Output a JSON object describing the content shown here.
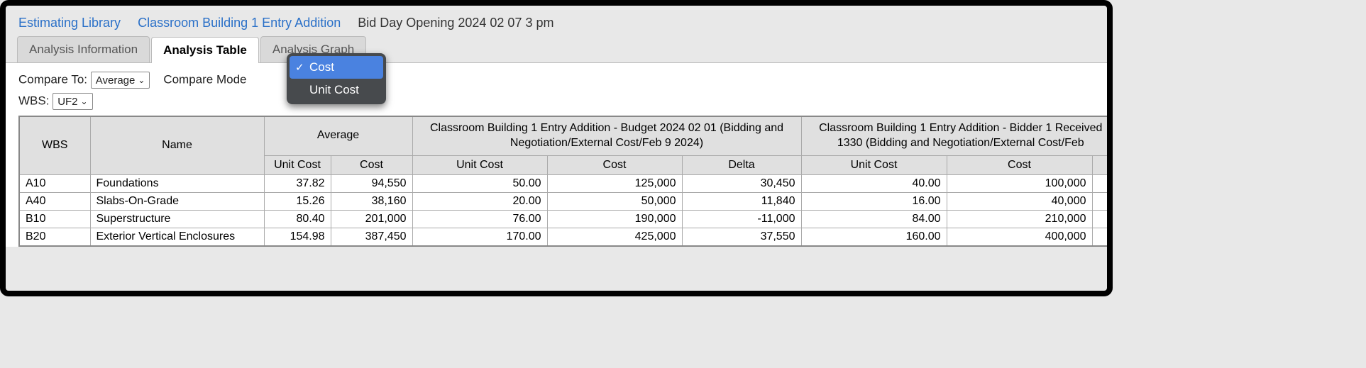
{
  "breadcrumb": {
    "lib": "Estimating Library",
    "proj": "Classroom Building 1 Entry Addition",
    "page": "Bid Day Opening 2024 02 07 3 pm"
  },
  "tabs": {
    "info": "Analysis Information",
    "table": "Analysis Table",
    "graph": "Analysis Graph"
  },
  "controls": {
    "compare_to_label": "Compare To:",
    "compare_to_value": "Average",
    "compare_mode_label": "Compare Mode",
    "wbs_label": "WBS:",
    "wbs_value": "UF2"
  },
  "dropdown": {
    "opt1": "Cost",
    "opt2": "Unit Cost"
  },
  "headers": {
    "wbs": "WBS",
    "name": "Name",
    "average": "Average",
    "budget1": "Classroom Building 1 Entry Addition - Budget 2024 02 01 (Bidding and Negotiation/External Cost/Feb 9 2024)",
    "bidder1": "Classroom Building 1 Entry Addition - Bidder 1 Received 1330 (Bidding and Negotiation/External Cost/Feb",
    "unit_cost": "Unit Cost",
    "cost": "Cost",
    "delta": "Delta"
  },
  "rows": {
    "r0": {
      "wbs": "A10",
      "name": "Foundations",
      "auc": "37.82",
      "ac": "94,550",
      "b1uc": "50.00",
      "b1c": "125,000",
      "b1d": "30,450",
      "b2uc": "40.00",
      "b2c": "100,000"
    },
    "r1": {
      "wbs": "A40",
      "name": "Slabs-On-Grade",
      "auc": "15.26",
      "ac": "38,160",
      "b1uc": "20.00",
      "b1c": "50,000",
      "b1d": "11,840",
      "b2uc": "16.00",
      "b2c": "40,000"
    },
    "r2": {
      "wbs": "B10",
      "name": "Superstructure",
      "auc": "80.40",
      "ac": "201,000",
      "b1uc": "76.00",
      "b1c": "190,000",
      "b1d": "-11,000",
      "b2uc": "84.00",
      "b2c": "210,000"
    },
    "r3": {
      "wbs": "B20",
      "name": "Exterior Vertical Enclosures",
      "auc": "154.98",
      "ac": "387,450",
      "b1uc": "170.00",
      "b1c": "425,000",
      "b1d": "37,550",
      "b2uc": "160.00",
      "b2c": "400,000"
    }
  }
}
